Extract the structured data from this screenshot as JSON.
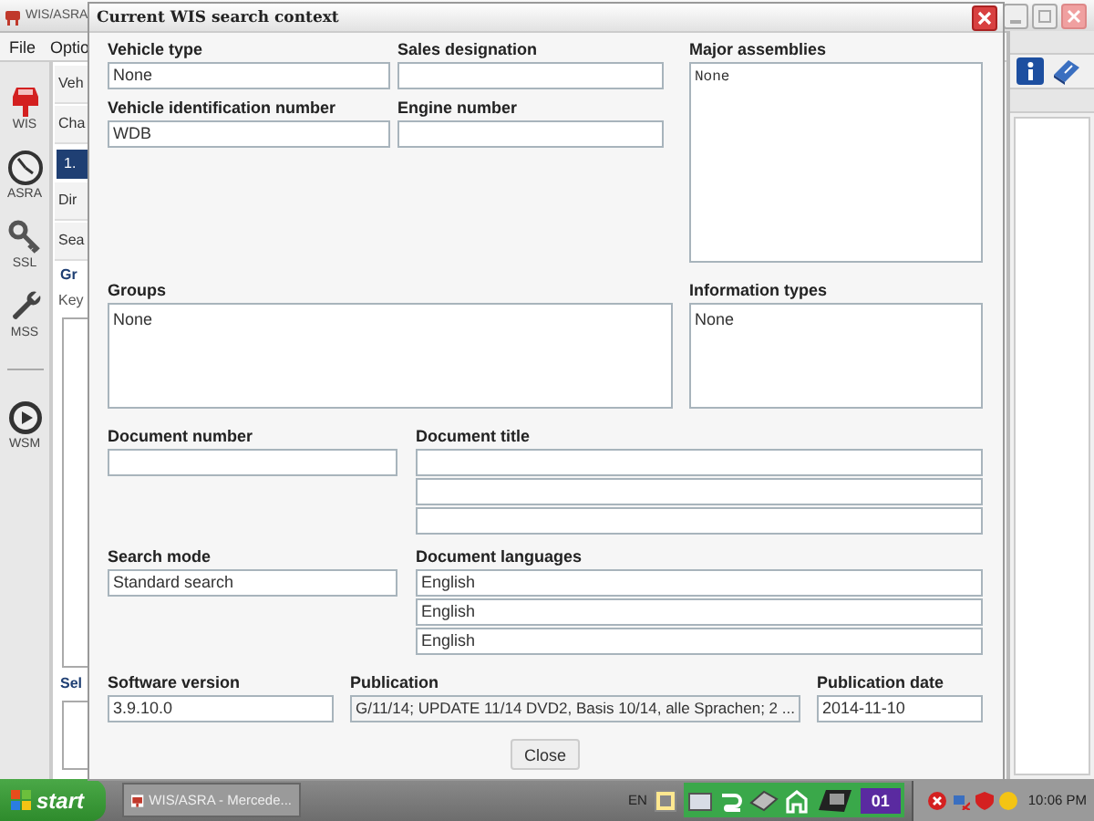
{
  "app": {
    "title": "WIS/ASRA",
    "menu": [
      "File",
      "Optio"
    ],
    "sidebar": [
      {
        "label": "WIS",
        "kind": "car"
      },
      {
        "label": "ASRA",
        "kind": "gauge"
      },
      {
        "label": "SSL",
        "kind": "key"
      },
      {
        "label": "MSS",
        "kind": "wrench"
      },
      {
        "label": "WSM",
        "kind": "play"
      }
    ],
    "panel": [
      {
        "text": "Veh",
        "kind": "row"
      },
      {
        "text": "Cha",
        "kind": "row"
      },
      {
        "text": "1.",
        "kind": "tab"
      },
      {
        "text": "Dir",
        "kind": "row"
      },
      {
        "text": "Sea",
        "kind": "row"
      },
      {
        "text": "Gr",
        "kind": "heading"
      },
      {
        "text": "Key",
        "kind": "label"
      },
      {
        "kind": "list"
      },
      {
        "text": "Sel",
        "kind": "heading"
      },
      {
        "kind": "list"
      }
    ]
  },
  "dialog": {
    "title": "Current WIS search context",
    "vehicle_type": {
      "label": "Vehicle type",
      "value": "None"
    },
    "sales_designation": {
      "label": "Sales designation"
    },
    "vin": {
      "label": "Vehicle identification number",
      "value": "WDB"
    },
    "engine_number": {
      "label": "Engine number"
    },
    "major_assemblies": {
      "label": "Major assemblies",
      "value": "None"
    },
    "groups": {
      "label": "Groups",
      "value": "None"
    },
    "information_types": {
      "label": "Information types",
      "value": "None"
    },
    "document_number": {
      "label": "Document number"
    },
    "document_title": {
      "label": "Document title"
    },
    "search_mode": {
      "label": "Search mode",
      "value": "Standard search"
    },
    "document_languages": {
      "label": "Document languages",
      "values": [
        "English",
        "English",
        "English"
      ]
    },
    "software_version": {
      "label": "Software version",
      "value": "3.9.10.0"
    },
    "publication": {
      "label": "Publication",
      "value": "G/11/14; UPDATE 11/14 DVD2, Basis 10/14, alle Sprachen; 2 ..."
    },
    "publication_date": {
      "label": "Publication date",
      "value": "2014-11-10"
    },
    "close_button": "Close"
  },
  "taskbar": {
    "start": "start",
    "task": "WIS/ASRA - Mercede...",
    "language": "EN",
    "badge": "01",
    "clock": "10:06 PM"
  }
}
